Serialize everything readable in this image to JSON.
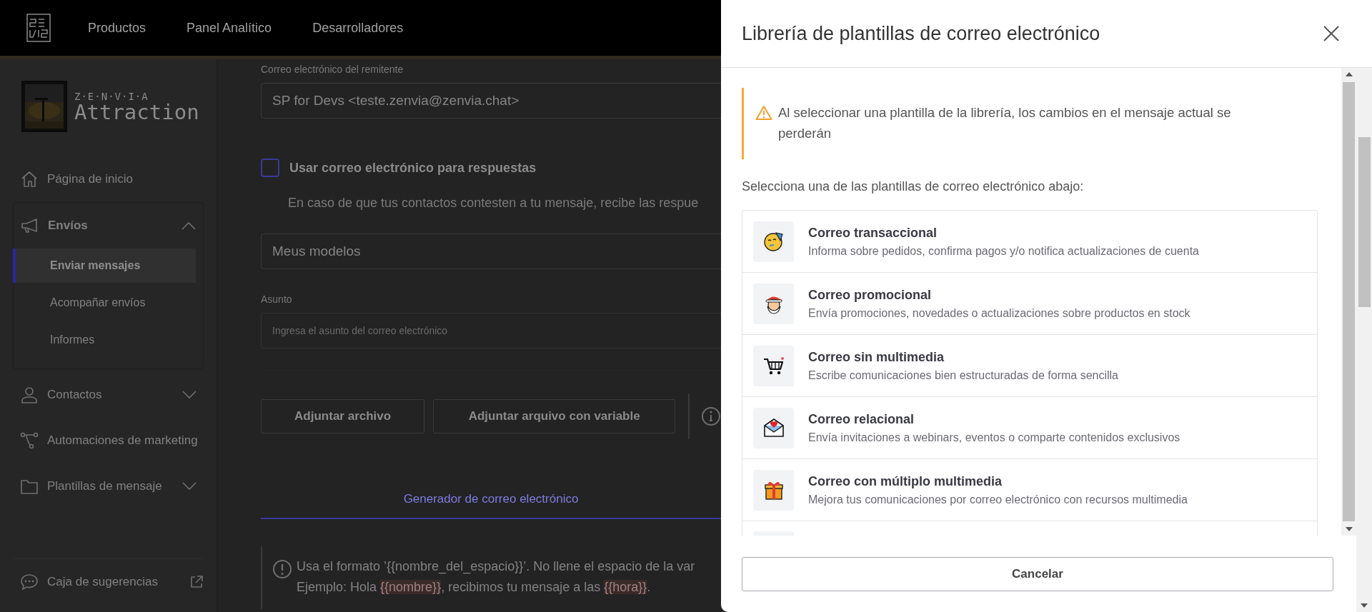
{
  "top_nav": {
    "items": [
      {
        "label": "Productos"
      },
      {
        "label": "Panel Analítico"
      },
      {
        "label": "Desarrolladores"
      }
    ]
  },
  "sidebar": {
    "brand": {
      "tagline": "Z·E·N·V·I·A",
      "name": "Attraction"
    },
    "items": [
      {
        "label": "Página de inicio",
        "kind": "link"
      },
      {
        "label": "Envíos",
        "kind": "group",
        "expanded": true,
        "children": [
          {
            "label": "Enviar mensajes",
            "selected": true
          },
          {
            "label": "Acompañar envíos",
            "selected": false
          },
          {
            "label": "Informes",
            "selected": false
          }
        ]
      },
      {
        "label": "Contactos",
        "kind": "group",
        "expanded": false
      },
      {
        "label": "Automaciones de marketing",
        "kind": "link"
      },
      {
        "label": "Plantillas de mensaje",
        "kind": "group",
        "expanded": false
      }
    ],
    "footer_link": {
      "label": "Caja de sugerencias"
    }
  },
  "form": {
    "sender": {
      "label": "Correo electrónico del remitente",
      "value": "SP for Devs <teste.zenvia@zenvia.chat>"
    },
    "reply_checkbox": {
      "label": "Usar correo electrónico para respuestas",
      "checked": false
    },
    "reply_hint": "En caso de que tus contactos contesten a tu mensaje, recibe las respue",
    "template_select": {
      "value": "Meus modelos"
    },
    "subject": {
      "label": "Asunto",
      "placeholder": "Ingresa el asunto del correo electrónico"
    },
    "buttons": [
      "Adjuntar archivo",
      "Adjuntar arquivo con variable"
    ],
    "tabs": [
      {
        "label": "Generador de correo electrónico",
        "selected": true
      }
    ],
    "notice": {
      "text": "Usa el formato ’{{nombre_del_espacio}}’. No llene el espacio de la var",
      "example": [
        {
          "text": "Ejemplo: Hola ",
          "kind": "plain"
        },
        {
          "text": "{{nombre}}",
          "kind": "variable"
        },
        {
          "text": ", recibimos tu mensaje a las ",
          "kind": "plain"
        },
        {
          "text": "{{hora}}",
          "kind": "variable"
        },
        {
          "text": ".",
          "kind": "plain"
        }
      ]
    }
  },
  "modal": {
    "title": "Librería de plantillas de correo electrónico",
    "warning": "Al seleccionar una plantilla de la librería, los cambios en el mensaje actual se perderán",
    "prompt": "Selecciona una de las plantillas de correo electrónico abajo:",
    "templates": [
      {
        "title": "Correo transaccional",
        "description": "Informa sobre pedidos, confirma pagos y/o notifica actualizaciones de cuenta"
      },
      {
        "title": "Correo promocional",
        "description": "Envía promociones, novedades o actualizaciones sobre productos en stock"
      },
      {
        "title": "Correo sin multimedia",
        "description": "Escribe comunicaciones bien estructuradas de forma sencilla"
      },
      {
        "title": "Correo relacional",
        "description": "Envía invitaciones a webinars, eventos o comparte contenidos exclusivos"
      },
      {
        "title": "Correo con múltiplo multimedia",
        "description": "Mejora tus comunicaciones por correo electrónico con recursos multimedia"
      }
    ],
    "cancel": "Cancelar"
  }
}
